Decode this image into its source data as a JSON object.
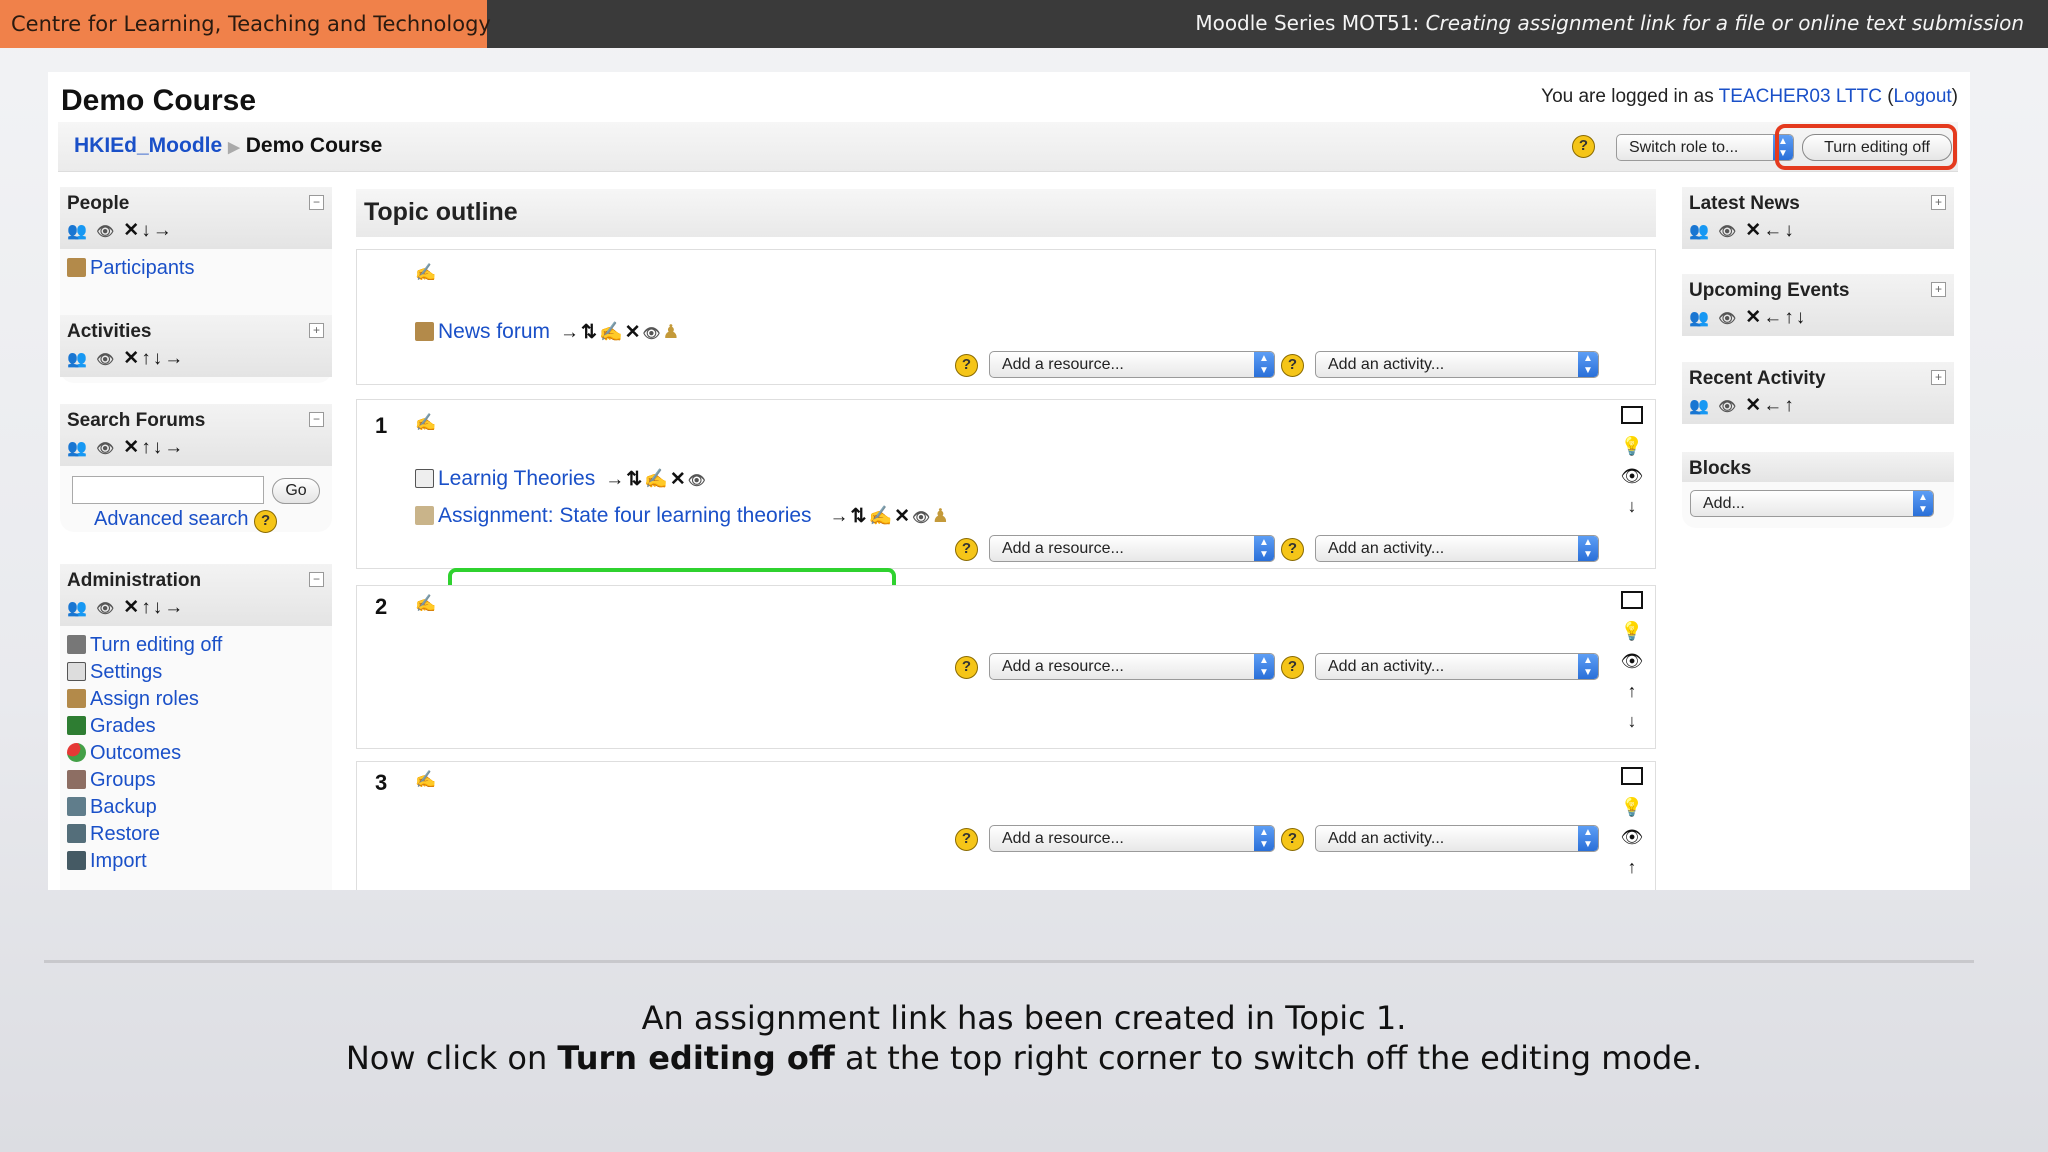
{
  "banner": {
    "org": "Centre for Learning, Teaching and Technology",
    "series_prefix": "Moodle Series MOT51: ",
    "series_title": "Creating assignment link for a file or online text submission"
  },
  "course": {
    "title": "Demo Course",
    "login_prefix": "You are logged in as ",
    "user": "TEACHER03 LTTC",
    "logout": "Logout"
  },
  "nav": {
    "home": "HKIEd_Moodle",
    "current": "Demo Course",
    "switch_role": "Switch role to...",
    "turn_editing_off": "Turn editing off",
    "help": "?"
  },
  "left_blocks": {
    "people": {
      "title": "People",
      "toggle": "−",
      "items": [
        "Participants"
      ]
    },
    "activities": {
      "title": "Activities",
      "toggle": "+"
    },
    "search": {
      "title": "Search Forums",
      "toggle": "−",
      "go": "Go",
      "advanced": "Advanced search"
    },
    "admin": {
      "title": "Administration",
      "toggle": "−",
      "items": [
        "Turn editing off",
        "Settings",
        "Assign roles",
        "Grades",
        "Outcomes",
        "Groups",
        "Backup",
        "Restore",
        "Import"
      ]
    }
  },
  "right_blocks": {
    "latest_news": {
      "title": "Latest News",
      "toggle": "+"
    },
    "upcoming": {
      "title": "Upcoming Events",
      "toggle": "+"
    },
    "recent": {
      "title": "Recent Activity",
      "toggle": "+"
    },
    "blocks": {
      "title": "Blocks",
      "add": "Add..."
    }
  },
  "outline": {
    "title": "Topic outline",
    "add_resource": "Add a resource...",
    "add_activity": "Add an activity...",
    "sections": [
      {
        "num": "",
        "activities": [
          "News forum"
        ]
      },
      {
        "num": "1",
        "activities": [
          "Learnig Theories",
          "Assignment: State four learning theories"
        ]
      },
      {
        "num": "2",
        "activities": []
      },
      {
        "num": "3",
        "activities": []
      }
    ]
  },
  "caption": {
    "line1": "An assignment link has been created in Topic 1.",
    "line2_pre": "Now click on ",
    "line2_bold": "Turn editing off",
    "line2_post": " at the top right corner to switch off the editing mode."
  },
  "colors": {
    "banner_orange": "#f0814a",
    "link_blue": "#1a50c8",
    "red_highlight": "#e43a1e",
    "green_highlight": "#2fd22f"
  }
}
